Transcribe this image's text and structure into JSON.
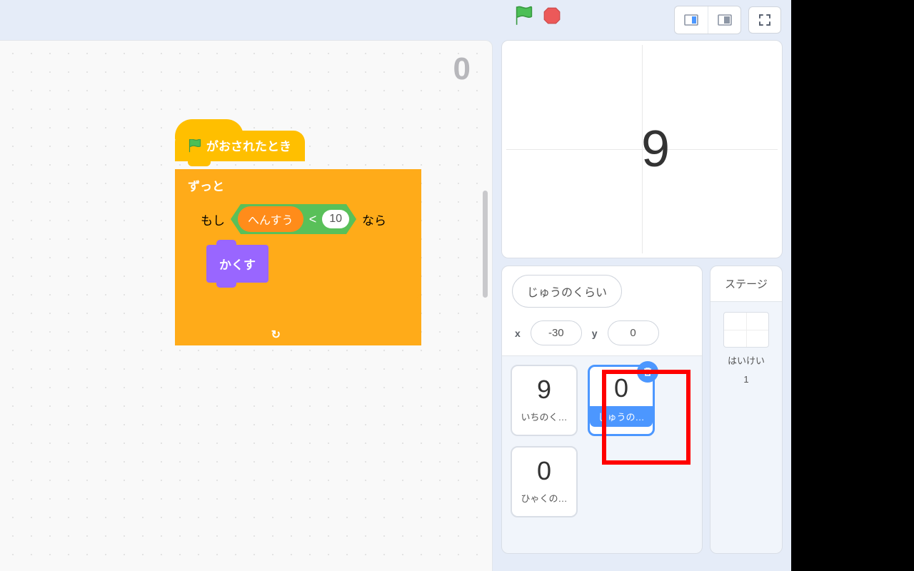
{
  "readout": "0",
  "blocks": {
    "hat_label": "がおされたとき",
    "forever_label": "ずっと",
    "if_label": "もし",
    "then_label": "なら",
    "variable_name": "へんすう",
    "compare_value": "10",
    "hide_label": "かくす"
  },
  "stage_display": "9",
  "sprite_info": {
    "name": "じゅうのくらい",
    "x_label": "x",
    "x_value": "-30",
    "y_label": "y",
    "y_value": "0"
  },
  "sprites": [
    {
      "display": "9",
      "label": "いちのく…"
    },
    {
      "display": "0",
      "label": "じゅうの…"
    },
    {
      "display": "0",
      "label": "ひゃくの…"
    }
  ],
  "stage_panel": {
    "title": "ステージ",
    "backdrop_label": "はいけい",
    "backdrop_count": "1"
  }
}
